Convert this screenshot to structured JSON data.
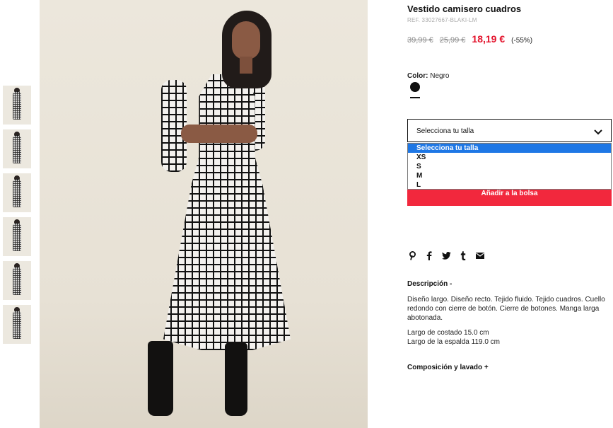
{
  "thumbnails": [
    "Vista 1",
    "Vista 2",
    "Vista 3",
    "Vista 4",
    "Vista 5",
    "Vista 6"
  ],
  "product": {
    "title": "Vestido camisero cuadros",
    "ref": "REF. 33027667-BLAKI-LM",
    "price_original": "39,99 €",
    "price_previous": "25,99 €",
    "price_sale": "18,19 €",
    "discount": "(-55%)"
  },
  "color": {
    "label": "Color:",
    "value": "Negro",
    "swatch": "#111111"
  },
  "size_select": {
    "placeholder": "Selecciona tu talla",
    "options": [
      "Selecciona tu talla",
      "XS",
      "S",
      "M",
      "L"
    ],
    "selected_index": 0
  },
  "add_to_bag": "Añadir a la bolsa",
  "share_icons": [
    "pinterest-icon",
    "facebook-icon",
    "twitter-icon",
    "tumblr-icon",
    "email-icon"
  ],
  "description": {
    "heading": "Descripción -",
    "text": "Diseño largo. Diseño recto. Tejido fluido. Tejido cuadros. Cuello redondo con cierre de botón. Cierre de botones. Manga larga abotonada.",
    "measure_1": "Largo de costado 15.0 cm",
    "measure_2": "Largo de la espalda 119.0 cm"
  },
  "composition": {
    "heading": "Composición y lavado +"
  },
  "colors": {
    "accent_red": "#e3122b",
    "button_red": "#f2283d",
    "select_highlight": "#1e77e5"
  }
}
